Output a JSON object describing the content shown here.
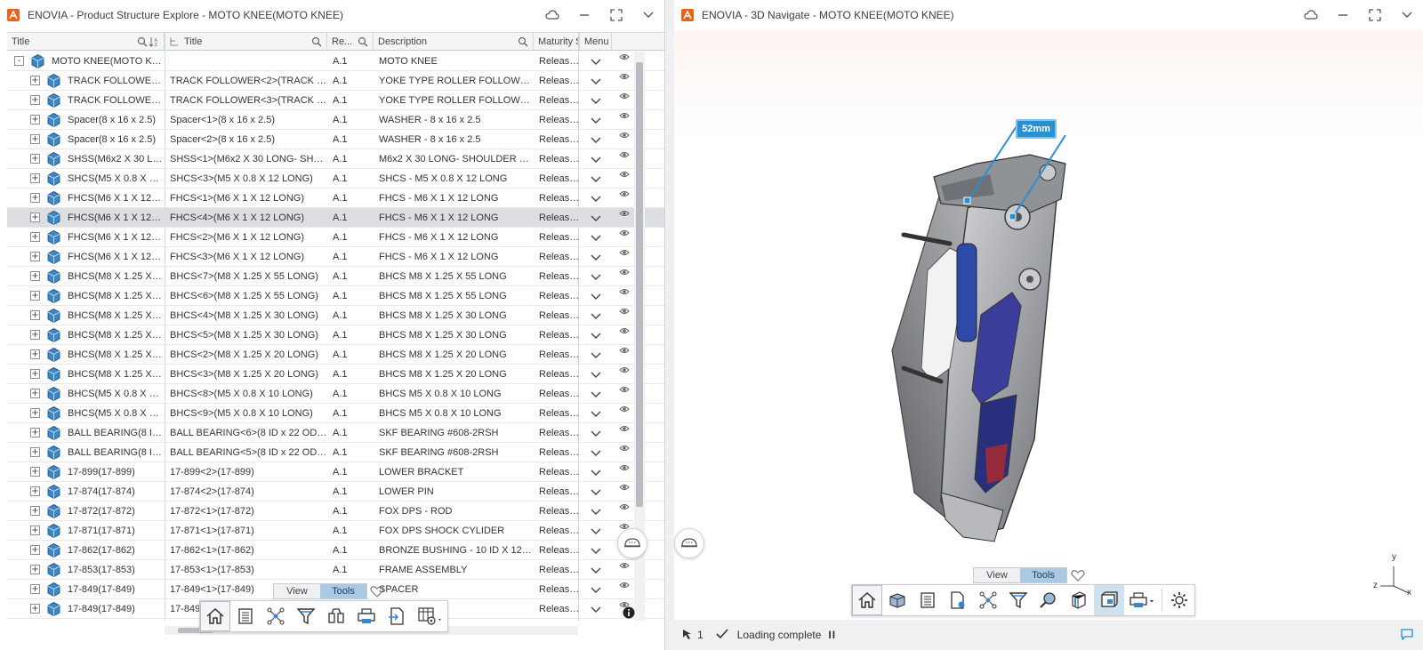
{
  "left_window": {
    "title": "ENOVIA - Product Structure Explore - MOTO KNEE(MOTO KNEE)"
  },
  "right_window": {
    "title": "ENOVIA - 3D Navigate - MOTO KNEE(MOTO KNEE)"
  },
  "grid": {
    "headers": {
      "title": "Title",
      "instance_title": "Title",
      "revision": "Re...",
      "description": "Description",
      "maturity": "Maturity S",
      "menu": "Menu"
    },
    "rows": [
      {
        "expand": "-",
        "title": "MOTO KNEE(MOTO KNEE)",
        "instance": "",
        "rev": "A.1",
        "desc": "MOTO KNEE",
        "maturity": "Released"
      },
      {
        "expand": "+",
        "title": "TRACK FOLLOWER(...",
        "instance": "TRACK FOLLOWER<2>(TRACK FO...",
        "rev": "A.1",
        "desc": "YOKE TYPE ROLLER FOLLOWER -...",
        "maturity": "Released"
      },
      {
        "expand": "+",
        "title": "TRACK FOLLOWER(...",
        "instance": "TRACK FOLLOWER<3>(TRACK FO...",
        "rev": "A.1",
        "desc": "YOKE TYPE ROLLER FOLLOWER -...",
        "maturity": "Released"
      },
      {
        "expand": "+",
        "title": "Spacer(8 x 16 x 2.5)",
        "instance": "Spacer<1>(8 x 16 x 2.5)",
        "rev": "A.1",
        "desc": "WASHER - 8 x 16 x 2.5",
        "maturity": "Released"
      },
      {
        "expand": "+",
        "title": "Spacer(8 x 16 x 2.5)",
        "instance": "Spacer<2>(8 x 16 x 2.5)",
        "rev": "A.1",
        "desc": "WASHER - 8 x 16 x 2.5",
        "maturity": "Released"
      },
      {
        "expand": "+",
        "title": "SHSS(M6x2 X 30 LO...",
        "instance": "SHSS<1>(M6x2 X 30 LONG- SHSS)",
        "rev": "A.1",
        "desc": "M6x2 X 30 LONG- SHOULDER SCR...",
        "maturity": "Released"
      },
      {
        "expand": "+",
        "title": "SHCS(M5 X 0.8 X 12 ...",
        "instance": "SHCS<3>(M5 X 0.8 X 12 LONG)",
        "rev": "A.1",
        "desc": "SHCS - M5 X 0.8 X 12 LONG",
        "maturity": "Released"
      },
      {
        "expand": "+",
        "title": "FHCS(M6 X 1 X 12 L...",
        "instance": "FHCS<1>(M6 X 1 X 12 LONG)",
        "rev": "A.1",
        "desc": "FHCS - M6 X 1 X 12 LONG",
        "maturity": "Released"
      },
      {
        "expand": "+",
        "title": "FHCS(M6 X 1 X 12 L...",
        "instance": "FHCS<4>(M6 X 1 X 12 LONG)",
        "rev": "A.1",
        "desc": "FHCS - M6 X 1 X 12 LONG",
        "maturity": "Released",
        "selected": true
      },
      {
        "expand": "+",
        "title": "FHCS(M6 X 1 X 12 L...",
        "instance": "FHCS<2>(M6 X 1 X 12 LONG)",
        "rev": "A.1",
        "desc": "FHCS - M6 X 1 X 12 LONG",
        "maturity": "Released"
      },
      {
        "expand": "+",
        "title": "FHCS(M6 X 1 X 12 L...",
        "instance": "FHCS<3>(M6 X 1 X 12 LONG)",
        "rev": "A.1",
        "desc": "FHCS - M6 X 1 X 12 LONG",
        "maturity": "Released"
      },
      {
        "expand": "+",
        "title": "BHCS(M8 X 1.25 X 5...",
        "instance": "BHCS<7>(M8 X 1.25 X 55 LONG)",
        "rev": "A.1",
        "desc": "BHCS M8 X 1.25 X 55 LONG",
        "maturity": "Released"
      },
      {
        "expand": "+",
        "title": "BHCS(M8 X 1.25 X 5...",
        "instance": "BHCS<6>(M8 X 1.25 X 55 LONG)",
        "rev": "A.1",
        "desc": "BHCS M8 X 1.25 X 55 LONG",
        "maturity": "Released"
      },
      {
        "expand": "+",
        "title": "BHCS(M8 X 1.25 X 3...",
        "instance": "BHCS<4>(M8 X 1.25 X 30 LONG)",
        "rev": "A.1",
        "desc": "BHCS M8 X 1.25 X 30 LONG",
        "maturity": "Released"
      },
      {
        "expand": "+",
        "title": "BHCS(M8 X 1.25 X 3...",
        "instance": "BHCS<5>(M8 X 1.25 X 30 LONG)",
        "rev": "A.1",
        "desc": "BHCS M8 X 1.25 X 30 LONG",
        "maturity": "Released"
      },
      {
        "expand": "+",
        "title": "BHCS(M8 X 1.25 X 2...",
        "instance": "BHCS<2>(M8 X 1.25 X 20 LONG)",
        "rev": "A.1",
        "desc": "BHCS M8 X 1.25 X 20 LONG",
        "maturity": "Released"
      },
      {
        "expand": "+",
        "title": "BHCS(M8 X 1.25 X 2...",
        "instance": "BHCS<3>(M8 X 1.25 X 20 LONG)",
        "rev": "A.1",
        "desc": "BHCS M8 X 1.25 X 20 LONG",
        "maturity": "Released"
      },
      {
        "expand": "+",
        "title": "BHCS(M5 X 0.8 X 10 ...",
        "instance": "BHCS<8>(M5 X 0.8 X 10 LONG)",
        "rev": "A.1",
        "desc": "BHCS M5 X 0.8 X 10 LONG",
        "maturity": "Released"
      },
      {
        "expand": "+",
        "title": "BHCS(M5 X 0.8 X 10 ...",
        "instance": "BHCS<9>(M5 X 0.8 X 10 LONG)",
        "rev": "A.1",
        "desc": "BHCS M5 X 0.8 X 10 LONG",
        "maturity": "Released"
      },
      {
        "expand": "+",
        "title": "BALL BEARING(8 ID ...",
        "instance": "BALL BEARING<6>(8 ID x 22 OD X 7...",
        "rev": "A.1",
        "desc": "SKF BEARING #608-2RSH",
        "maturity": "Released"
      },
      {
        "expand": "+",
        "title": "BALL BEARING(8 ID ...",
        "instance": "BALL BEARING<5>(8 ID x 22 OD X 7...",
        "rev": "A.1",
        "desc": "SKF BEARING #608-2RSH",
        "maturity": "Released"
      },
      {
        "expand": "+",
        "title": "17-899(17-899)",
        "instance": "17-899<2>(17-899)",
        "rev": "A.1",
        "desc": "LOWER BRACKET",
        "maturity": "Released"
      },
      {
        "expand": "+",
        "title": "17-874(17-874)",
        "instance": "17-874<2>(17-874)",
        "rev": "A.1",
        "desc": "LOWER PIN",
        "maturity": "Released"
      },
      {
        "expand": "+",
        "title": "17-872(17-872)",
        "instance": "17-872<1>(17-872)",
        "rev": "A.1",
        "desc": "FOX DPS - ROD",
        "maturity": "Released"
      },
      {
        "expand": "+",
        "title": "17-871(17-871)",
        "instance": "17-871<1>(17-871)",
        "rev": "A.1",
        "desc": "FOX DPS SHOCK CYLIDER",
        "maturity": "Released"
      },
      {
        "expand": "+",
        "title": "17-862(17-862)",
        "instance": "17-862<1>(17-862)",
        "rev": "A.1",
        "desc": "BRONZE BUSHING - 10 ID X 12 OD...",
        "maturity": "Released"
      },
      {
        "expand": "+",
        "title": "17-853(17-853)",
        "instance": "17-853<1>(17-853)",
        "rev": "A.1",
        "desc": "FRAME ASSEMBLY",
        "maturity": "Released"
      },
      {
        "expand": "+",
        "title": "17-849(17-849)",
        "instance": "17-849<1>(17-849)",
        "rev": "A.1",
        "desc": "SPACER",
        "maturity": "Released"
      },
      {
        "expand": "+",
        "title": "17-849(17-849)",
        "instance": "17-849<",
        "rev": "A.1",
        "desc": "",
        "maturity": "Released"
      }
    ]
  },
  "left_toolbar": {
    "tab_view": "View",
    "tab_tools": "Tools",
    "active_tab": "Tools",
    "icons": [
      "home-icon",
      "table-view-icon",
      "graph-view-icon",
      "filter-icon",
      "compare-icon",
      "print-icon",
      "export-icon",
      "table-settings-icon"
    ]
  },
  "right_toolbar": {
    "tab_view": "View",
    "tab_tools": "Tools",
    "active_tab": "Tools",
    "icons": [
      "home-icon",
      "3d-view-icon",
      "list-icon",
      "document-tag-icon",
      "graph-view-icon",
      "filter-icon",
      "search-3d-icon",
      "section-icon",
      "box-view-icon",
      "print-icon",
      "settings-icon"
    ]
  },
  "viewport": {
    "measurement": "52mm",
    "compass": {
      "x": "x",
      "y": "y",
      "z": "z"
    }
  },
  "statusbar": {
    "selection_count": "1",
    "message": "Loading complete",
    "pause_label": "II"
  },
  "colors": {
    "accent_blue": "#2a8fd0",
    "part_icon_blue": "#3a86c8",
    "tab_active": "#a9c9e4",
    "selected_row": "#dcdee1",
    "app_logo": "#e8621c"
  }
}
